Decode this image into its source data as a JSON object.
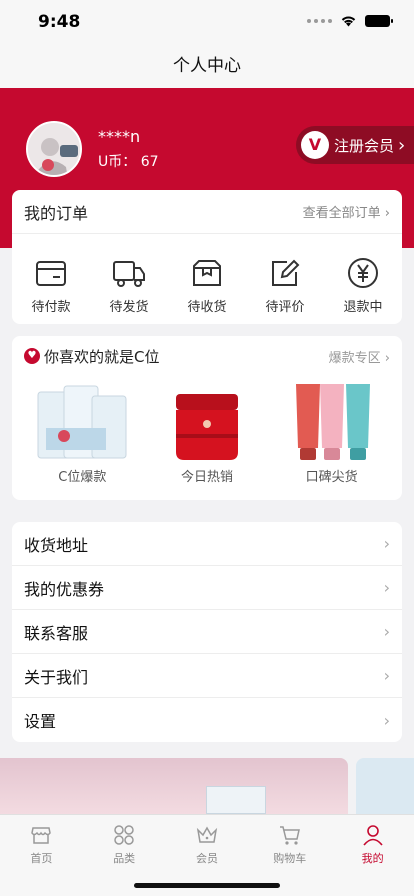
{
  "status": {
    "time": "9:48"
  },
  "nav": {
    "title": "个人中心"
  },
  "profile": {
    "username": "****n",
    "ucoin": "U币： 67",
    "member_label": "注册会员",
    "member_logo": "V"
  },
  "orders": {
    "title": "我的订单",
    "view_all": "查看全部订单",
    "items": [
      {
        "label": "待付款",
        "icon": "wallet-icon"
      },
      {
        "label": "待发货",
        "icon": "truck-icon"
      },
      {
        "label": "待收货",
        "icon": "package-icon"
      },
      {
        "label": "待评价",
        "icon": "edit-icon"
      },
      {
        "label": "退款中",
        "icon": "yen-icon"
      }
    ]
  },
  "cpos": {
    "title": "你喜欢的就是C位",
    "more": "爆款专区",
    "products": [
      {
        "label": "C位爆款"
      },
      {
        "label": "今日热销"
      },
      {
        "label": "口碑尖货"
      }
    ]
  },
  "menu": [
    {
      "label": "收货地址"
    },
    {
      "label": "我的优惠券"
    },
    {
      "label": "联系客服"
    },
    {
      "label": "关于我们"
    },
    {
      "label": "设置"
    }
  ],
  "tabs": [
    {
      "label": "首页",
      "icon": "home-icon"
    },
    {
      "label": "品类",
      "icon": "category-icon"
    },
    {
      "label": "会员",
      "icon": "crown-icon"
    },
    {
      "label": "购物车",
      "icon": "cart-icon"
    },
    {
      "label": "我的",
      "icon": "user-icon"
    }
  ],
  "colors": {
    "brand": "#c5092f",
    "brand_dark": "#8e0c24"
  }
}
